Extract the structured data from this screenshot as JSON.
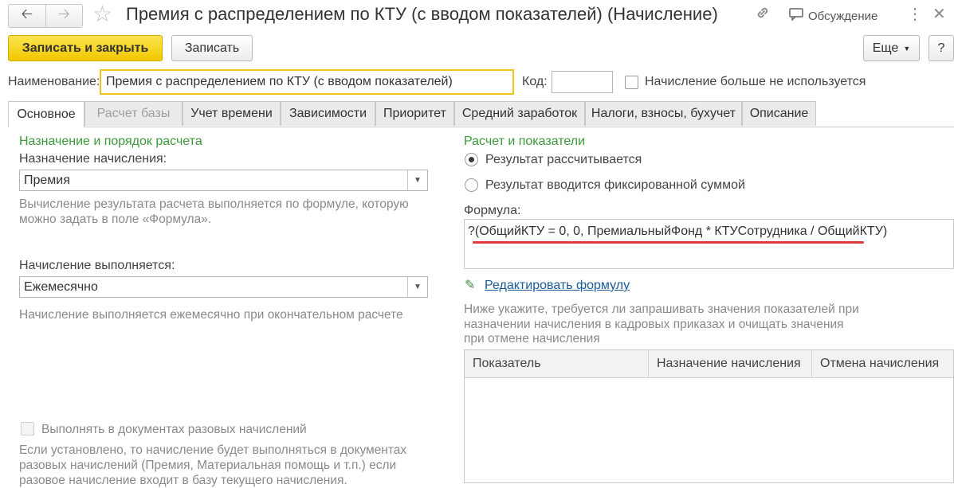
{
  "header": {
    "title": "Премия с распределением по КТУ (с вводом показателей) (Начисление)",
    "discussion_label": "Обсуждение"
  },
  "toolbar": {
    "save_close_label": "Записать и закрыть",
    "save_label": "Записать",
    "more_label": "Еще",
    "help_label": "?"
  },
  "form": {
    "name_label": "Наименование:",
    "name_value": "Премия с распределением по КТУ (с вводом показателей)",
    "code_label": "Код:",
    "code_value": "",
    "unused_label": "Начисление больше не используется"
  },
  "tabs": [
    {
      "label": "Основное"
    },
    {
      "label": "Расчет базы"
    },
    {
      "label": "Учет времени"
    },
    {
      "label": "Зависимости"
    },
    {
      "label": "Приоритет"
    },
    {
      "label": "Средний заработок"
    },
    {
      "label": "Налоги, взносы, бухучет"
    },
    {
      "label": "Описание"
    }
  ],
  "left": {
    "section_title": "Назначение и порядок расчета",
    "purpose_label": "Назначение начисления:",
    "purpose_value": "Премия",
    "purpose_hint": "Вычисление результата расчета выполняется по формуле, которую можно задать в поле «Формула».",
    "exec_label": "Начисление выполняется:",
    "exec_value": "Ежемесячно",
    "exec_hint": "Начисление выполняется ежемесячно при окончательном расчете",
    "onetime_label": "Выполнять в документах разовых начислений",
    "onetime_hint": "Если установлено, то начисление будет выполняться в документах разовых начислений (Премия, Материальная помощь и т.п.) если разовое начисление входит в базу текущего начисления."
  },
  "right": {
    "section_title": "Расчет и показатели",
    "radio_calc": "Результат рассчитывается",
    "radio_fixed": "Результат вводится фиксированной суммой",
    "formula_label": "Формула:",
    "formula_value": "?(ОбщийКТУ = 0, 0, ПремиальныйФонд * КТУСотрудника / ОбщийКТУ)",
    "edit_formula_link": "Редактировать формулу",
    "indicators_hint": "Ниже укажите, требуется ли запрашивать значения показателей при назначении начисления в кадровых приказах и очищать значения при отмене начисления",
    "table_headers": [
      "Показатель",
      "Назначение начисления",
      "Отмена начисления"
    ]
  },
  "colors": {
    "accent_yellow": "#f2c700",
    "section_green": "#3c9a3c",
    "underline_red": "#e03a3a",
    "link_blue": "#1a5a9a"
  }
}
